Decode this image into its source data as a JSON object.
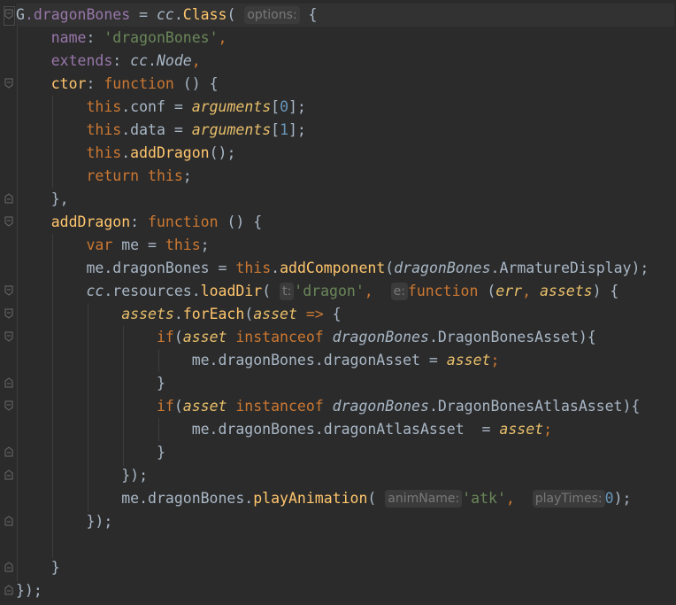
{
  "editor": {
    "hints": {
      "options": "options:",
      "t": "t:",
      "e": "e:",
      "animName": "animName:",
      "playTimes": "playTimes:"
    },
    "lines": [
      "G.dragonBones = cc.Class( options: {",
      "    name: 'dragonBones',",
      "    extends: cc.Node,",
      "    ctor: function () {",
      "        this.conf = arguments[0];",
      "        this.data = arguments[1];",
      "        this.addDragon();",
      "        return this;",
      "    },",
      "    addDragon: function () {",
      "        var me = this;",
      "        me.dragonBones = this.addComponent(dragonBones.ArmatureDisplay);",
      "        cc.resources.loadDir( t: 'dragon',  e: function (err, assets) {",
      "            assets.forEach(asset => {",
      "                if(asset instanceof dragonBones.DragonBonesAsset){",
      "                    me.dragonBones.dragonAsset = asset;",
      "                }",
      "                if(asset instanceof dragonBones.DragonBonesAtlasAsset){",
      "                    me.dragonBones.dragonAtlasAsset  = asset;",
      "                }",
      "            });",
      "            me.dragonBones.playAnimation( animName: 'atk',  playTimes: 0);",
      "        });",
      "",
      "    }",
      "});"
    ],
    "tokens": {
      "l0": [
        "G",
        ".dragonBones ",
        "= ",
        "cc",
        ".",
        "Class",
        "( ",
        "{"
      ],
      "l1": [
        "name",
        ": ",
        "'dragonBones'",
        ","
      ],
      "l2": [
        "extends",
        ": ",
        "cc",
        ".",
        "Node",
        ","
      ],
      "l3": [
        "ctor",
        ": ",
        "function ",
        "() {"
      ],
      "l4": [
        "this",
        ".",
        "conf ",
        "= ",
        "arguments",
        "[",
        "0",
        "];"
      ],
      "l5": [
        "this",
        ".",
        "data ",
        "= ",
        "arguments",
        "[",
        "1",
        "];"
      ],
      "l6": [
        "this",
        ".",
        "addDragon",
        "();"
      ],
      "l7": [
        "return ",
        "this",
        ";"
      ],
      "l8": [
        "},"
      ],
      "l9": [
        "addDragon",
        ": ",
        "function ",
        "() {"
      ],
      "l10": [
        "var ",
        "me ",
        "= ",
        "this",
        ";"
      ],
      "l11": [
        "me.",
        "dragonBones ",
        "= ",
        "this",
        ".",
        "addComponent",
        "(",
        "dragonBones",
        ".ArmatureDisplay);"
      ],
      "l12": [
        "cc",
        ".resources.",
        "loadDir",
        "( ",
        "'dragon'",
        ",  ",
        "function ",
        "(",
        "err",
        ", ",
        "assets",
        ") {"
      ],
      "l13": [
        "assets",
        ".",
        "forEach",
        "(",
        "asset ",
        "=> ",
        "{"
      ],
      "l14": [
        "if",
        "(",
        "asset ",
        "instanceof ",
        "dragonBones",
        ".DragonBonesAsset){"
      ],
      "l15": [
        "me.dragonBones.dragonAsset ",
        "= ",
        "asset",
        ";"
      ],
      "l16": [
        "}"
      ],
      "l17": [
        "if",
        "(",
        "asset ",
        "instanceof ",
        "dragonBones",
        ".DragonBonesAtlasAsset){"
      ],
      "l18": [
        "me.dragonBones.dragonAtlasAsset  ",
        "= ",
        "asset",
        ";"
      ],
      "l19": [
        "}"
      ],
      "l20": [
        "});"
      ],
      "l21": [
        "me.dragonBones.",
        "playAnimation",
        "( ",
        "'atk'",
        ",  ",
        "0",
        ");"
      ],
      "l22": [
        "});"
      ],
      "l24": [
        "}"
      ],
      "l25": [
        "});"
      ]
    }
  },
  "colors": {
    "background": "#2b2b2b",
    "keyword": "#cc7832",
    "string": "#6a8759",
    "number": "#6897bb",
    "field": "#9876aa",
    "method": "#ffc66d",
    "text": "#a9b7c6"
  }
}
